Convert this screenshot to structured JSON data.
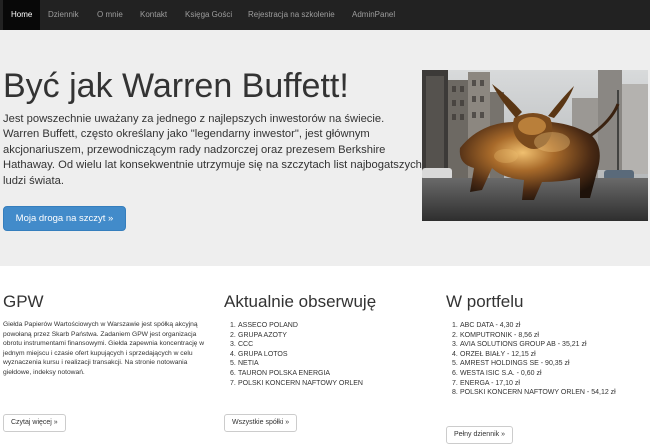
{
  "nav": {
    "items": [
      {
        "label": "Home",
        "active": true
      },
      {
        "label": "Dziennik"
      },
      {
        "label": "O mnie"
      },
      {
        "label": "Kontakt"
      },
      {
        "label": "Księga Gości"
      },
      {
        "label": "Rejestracja na szkolenie"
      },
      {
        "label": "AdminPanel"
      }
    ]
  },
  "hero": {
    "title": "Być jak Warren Buffett!",
    "text": "Jest powszechnie uważany za jednego z najlepszych inwestorów na świecie. Warren Buffett, często określany jako \"legendarny inwestor\", jest głównym akcjonariuszem, przewodniczącym rady nadzorczej oraz prezesem Berkshire Hathaway. Od wielu lat konsekwentnie utrzymuje się na szczytach list najbogatszych ludzi świata.",
    "button": "Moja droga na szczyt »",
    "image": "charging-bull-statue"
  },
  "columns": {
    "gpw": {
      "title": "GPW",
      "text": "Giełda Papierów Wartościowych w Warszawie jest spółką akcyjną powołaną przez Skarb Państwa. Zadaniem GPW jest organizacja obrotu instrumentami finansowymi. Giełda zapewnia koncentrację w jednym miejscu i czasie ofert kupujących i sprzedających w celu wyznaczenia kursu i realizacji transakcji. Na stronie notowania giełdowe, indeksy notowań.",
      "button": "Czytaj więcej »"
    },
    "watch": {
      "title": "Aktualnie obserwuję",
      "items": [
        {
          "num": "1.",
          "text": "ASSECO POLAND"
        },
        {
          "num": "2.",
          "text": "GRUPA AZOTY"
        },
        {
          "num": "3.",
          "text": "CCC"
        },
        {
          "num": "4.",
          "text": "GRUPA LOTOS"
        },
        {
          "num": "5.",
          "text": "NETIA"
        },
        {
          "num": "6.",
          "text": "TAURON POLSKA ENERGIA"
        },
        {
          "num": "7.",
          "text": "POLSKI KONCERN NAFTOWY ORLEN"
        }
      ],
      "button": "Wszystkie spółki »"
    },
    "portfolio": {
      "title": "W portfelu",
      "items": [
        {
          "num": "1.",
          "text": "ABC DATA - 4,30 zł"
        },
        {
          "num": "2.",
          "text": "KOMPUTRONIK - 8,56 zł"
        },
        {
          "num": "3.",
          "text": "AVIA SOLUTIONS GROUP AB - 35,21 zł"
        },
        {
          "num": "4.",
          "text": "ORZEŁ BIAŁY - 12,15 zł"
        },
        {
          "num": "5.",
          "text": "AMREST HOLDINGS SE - 90,35 zł"
        },
        {
          "num": "6.",
          "text": "WESTA ISIC S.A. - 0,60 zł"
        },
        {
          "num": "7.",
          "text": "ENERGA - 17,10 zł"
        },
        {
          "num": "8.",
          "text": "POLSKI KONCERN NAFTOWY ORLEN - 54,12 zł"
        }
      ],
      "button": "Pełny dziennik »"
    }
  }
}
